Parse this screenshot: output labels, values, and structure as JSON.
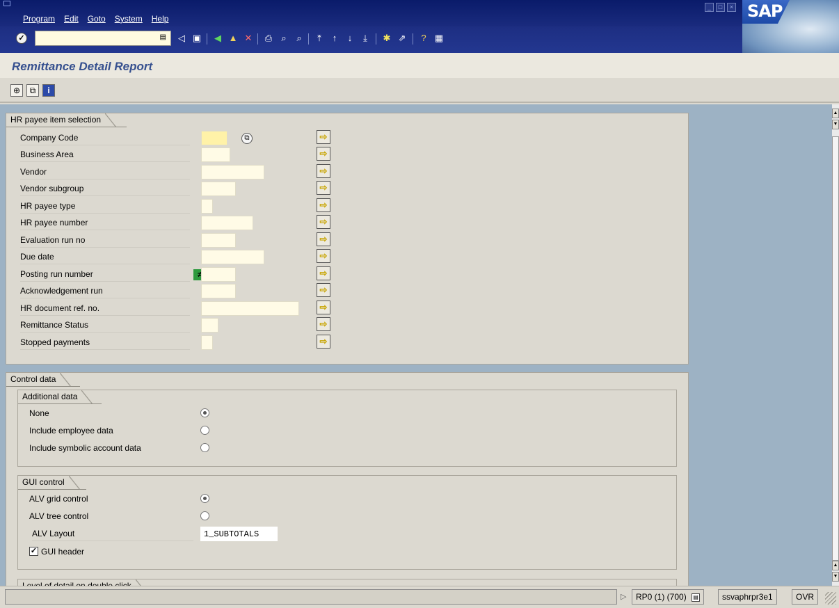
{
  "menu": {
    "items": [
      "Program",
      "Edit",
      "Goto",
      "System",
      "Help"
    ]
  },
  "logo": "SAP",
  "toolbar": {
    "command_value": "",
    "icons": [
      "enter-icon",
      "back-icon",
      "save-icon",
      "back-green-icon",
      "exit-icon",
      "cancel-icon",
      "print-icon",
      "find-icon",
      "find-next-icon",
      "first-page-icon",
      "previous-page-icon",
      "next-page-icon",
      "last-page-icon",
      "create-session-icon",
      "shortcut-icon",
      "help-icon",
      "layout-icon"
    ]
  },
  "title": "Remittance Detail Report",
  "app_toolbar": {
    "icons": [
      "execute-icon",
      "get-variant-icon",
      "info-icon"
    ]
  },
  "selection": {
    "title": "HR payee item selection",
    "rows": [
      {
        "label": "Company Code",
        "value": ""
      },
      {
        "label": "Business Area",
        "value": ""
      },
      {
        "label": "Vendor",
        "value": ""
      },
      {
        "label": "Vendor subgroup",
        "value": ""
      },
      {
        "label": "HR payee type",
        "value": ""
      },
      {
        "label": "HR payee number",
        "value": ""
      },
      {
        "label": "Evaluation run no",
        "value": ""
      },
      {
        "label": "Due date",
        "value": ""
      },
      {
        "label": "Posting run number",
        "value": ""
      },
      {
        "label": "Acknowledgement run",
        "value": ""
      },
      {
        "label": "HR document ref. no.",
        "value": ""
      },
      {
        "label": "Remittance Status",
        "value": ""
      },
      {
        "label": "Stopped payments",
        "value": ""
      }
    ],
    "posting_option_symbol": "≠",
    "multiple_selection_symbol": "⇨"
  },
  "control": {
    "title": "Control data",
    "additional": {
      "title": "Additional data",
      "options": [
        {
          "label": "None",
          "selected": true
        },
        {
          "label": "Include employee data",
          "selected": false
        },
        {
          "label": "Include symbolic account data",
          "selected": false
        }
      ]
    },
    "gui": {
      "title": "GUI control",
      "options": [
        {
          "label": "ALV grid control",
          "selected": true
        },
        {
          "label": "ALV tree control",
          "selected": false
        }
      ],
      "layout_label": "ALV Layout",
      "layout_value": "1_SUBTOTALS",
      "header_label": "GUI header",
      "header_checked": true
    },
    "detail": {
      "title": "Level of detail on double click"
    }
  },
  "status": {
    "message": "",
    "system": "RP0 (1) (700)",
    "server": "ssvaphrpr3e1",
    "mode": "OVR"
  }
}
